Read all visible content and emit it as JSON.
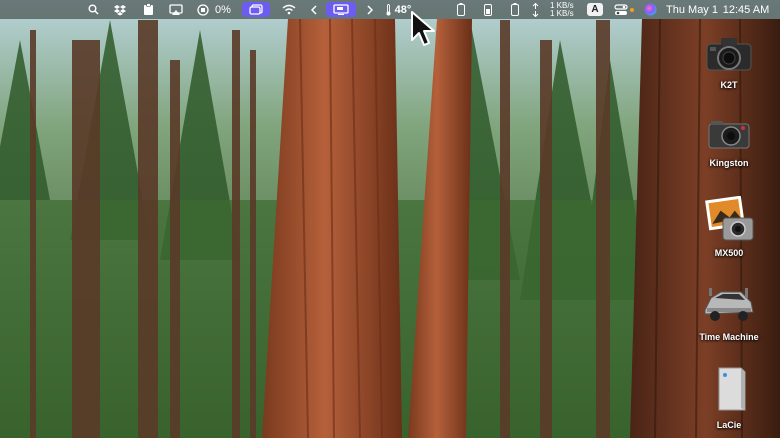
{
  "menubar": {
    "icons": [
      "search-icon",
      "dropbox-icon",
      "clipboard-icon",
      "airplay-icon",
      "stop-record-icon",
      "stage-manager-icon",
      "wifi-icon",
      "chevron-left-icon",
      "screen-share-icon",
      "chevron-right-icon",
      "battery-icon",
      "battery-icon",
      "battery-icon",
      "network-arrows-icon",
      "control-center-icon",
      "siri-icon"
    ],
    "recording_percent": "0%",
    "stat_value": "48°",
    "net_up": "1 KB/s",
    "net_down": "1 KB/s",
    "input_source": "A",
    "date": "Thu May 1",
    "time": "12:45 AM",
    "accent_color": "#6c5cf2"
  },
  "desktop": {
    "wallpaper": "redwood-forest",
    "items": [
      {
        "label": "K2T",
        "icon": "dslr-camera-icon"
      },
      {
        "label": "Kingston",
        "icon": "compact-camera-icon"
      },
      {
        "label": "MX500",
        "icon": "photo-camera-icon"
      },
      {
        "label": "Time Machine",
        "icon": "time-machine-icon"
      },
      {
        "label": "LaCie",
        "icon": "external-drive-icon"
      }
    ]
  }
}
